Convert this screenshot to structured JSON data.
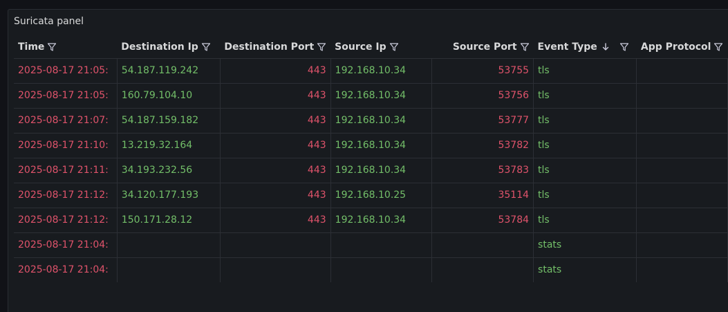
{
  "panel": {
    "title": "Suricata panel"
  },
  "columns": [
    {
      "label": "Time",
      "align": "left",
      "sorted": false
    },
    {
      "label": "Destination Ip",
      "align": "left",
      "sorted": false
    },
    {
      "label": "Destination Port",
      "align": "right",
      "sorted": false
    },
    {
      "label": "Source Ip",
      "align": "left",
      "sorted": false
    },
    {
      "label": "Source Port",
      "align": "right",
      "sorted": false
    },
    {
      "label": "Event Type",
      "align": "left",
      "sorted": true,
      "sort_direction": "descending"
    },
    {
      "label": "App Protocol",
      "align": "left",
      "sorted": false
    }
  ],
  "rows": [
    {
      "time": "2025-08-17 21:05:",
      "dest_ip": "54.187.119.242",
      "dest_port": "443",
      "src_ip": "192.168.10.34",
      "src_port": "53755",
      "event_type": "tls",
      "app_protocol": ""
    },
    {
      "time": "2025-08-17 21:05:",
      "dest_ip": "160.79.104.10",
      "dest_port": "443",
      "src_ip": "192.168.10.34",
      "src_port": "53756",
      "event_type": "tls",
      "app_protocol": ""
    },
    {
      "time": "2025-08-17 21:07:",
      "dest_ip": "54.187.159.182",
      "dest_port": "443",
      "src_ip": "192.168.10.34",
      "src_port": "53777",
      "event_type": "tls",
      "app_protocol": ""
    },
    {
      "time": "2025-08-17 21:10:",
      "dest_ip": "13.219.32.164",
      "dest_port": "443",
      "src_ip": "192.168.10.34",
      "src_port": "53782",
      "event_type": "tls",
      "app_protocol": ""
    },
    {
      "time": "2025-08-17 21:11:",
      "dest_ip": "34.193.232.56",
      "dest_port": "443",
      "src_ip": "192.168.10.34",
      "src_port": "53783",
      "event_type": "tls",
      "app_protocol": ""
    },
    {
      "time": "2025-08-17 21:12:",
      "dest_ip": "34.120.177.193",
      "dest_port": "443",
      "src_ip": "192.168.10.25",
      "src_port": "35114",
      "event_type": "tls",
      "app_protocol": ""
    },
    {
      "time": "2025-08-17 21:12:",
      "dest_ip": "150.171.28.12",
      "dest_port": "443",
      "src_ip": "192.168.10.34",
      "src_port": "53784",
      "event_type": "tls",
      "app_protocol": ""
    },
    {
      "time": "2025-08-17 21:04:",
      "dest_ip": "",
      "dest_port": "",
      "src_ip": "",
      "src_port": "",
      "event_type": "stats",
      "app_protocol": ""
    },
    {
      "time": "2025-08-17 21:04:",
      "dest_ip": "",
      "dest_port": "",
      "src_ip": "",
      "src_port": "",
      "event_type": "stats",
      "app_protocol": ""
    }
  ],
  "colors": {
    "background": "#111217",
    "panel": "#181b1f",
    "header_text": "#d8d9da",
    "red_value": "#e0536b",
    "green_value": "#73bf69",
    "grid_line": "#2c2f35"
  },
  "icons": {
    "filter": "filter-icon",
    "sort": "arrow-down-icon"
  }
}
